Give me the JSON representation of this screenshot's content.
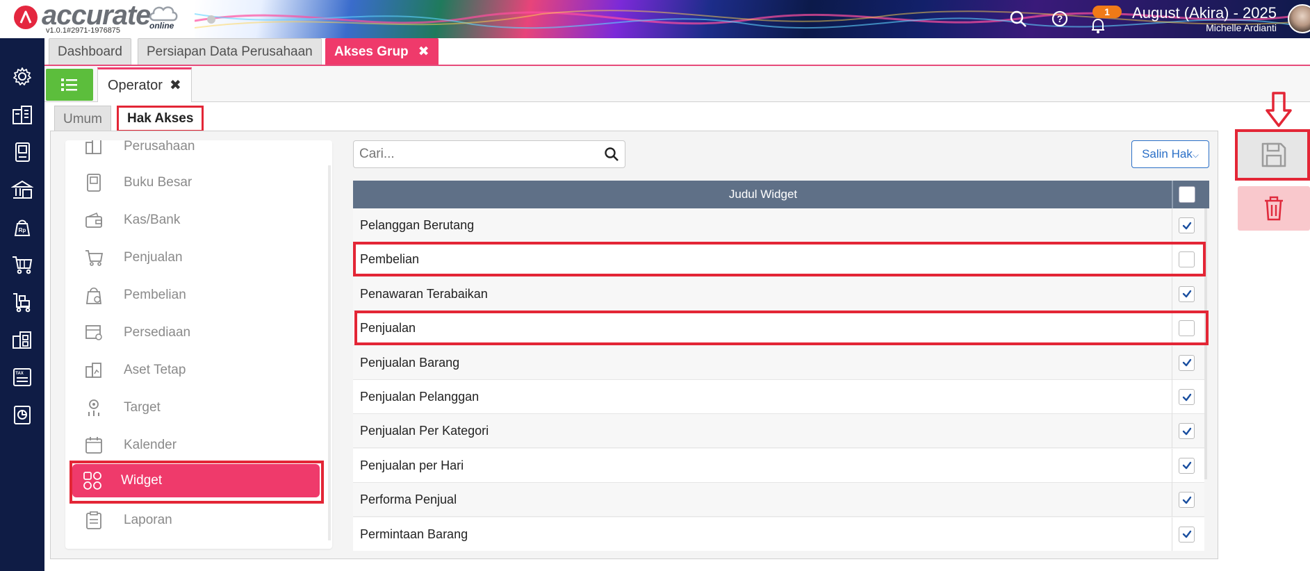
{
  "app": {
    "logo_text": "accurate",
    "logo_subtext": "online",
    "version": "v1.0.1#2971-1976875"
  },
  "header": {
    "notification_count": "1",
    "company": "August (Akira) - 2025",
    "user": "Michelle Ardianti"
  },
  "main_tabs": [
    {
      "label": "Dashboard"
    },
    {
      "label": "Persiapan Data Perusahaan"
    },
    {
      "label": "Akses Grup",
      "close": "✖"
    }
  ],
  "operator_tab": {
    "label": "Operator",
    "close": "✖"
  },
  "inner_tabs": [
    {
      "label": "Umum"
    },
    {
      "label": "Hak Akses"
    }
  ],
  "menu": {
    "items": [
      {
        "label": "Perusahaan",
        "icon": "building-icon"
      },
      {
        "label": "Buku Besar",
        "icon": "ledger-icon"
      },
      {
        "label": "Kas/Bank",
        "icon": "wallet-icon"
      },
      {
        "label": "Penjualan",
        "icon": "cart-icon"
      },
      {
        "label": "Pembelian",
        "icon": "shopping-bag-icon"
      },
      {
        "label": "Persediaan",
        "icon": "inventory-icon"
      },
      {
        "label": "Aset Tetap",
        "icon": "asset-icon"
      },
      {
        "label": "Target",
        "icon": "target-icon"
      },
      {
        "label": "Kalender",
        "icon": "calendar-icon"
      },
      {
        "label": "Widget",
        "icon": "widget-icon",
        "active": true
      },
      {
        "label": "Laporan",
        "icon": "report-icon"
      }
    ]
  },
  "search": {
    "placeholder": "Cari..."
  },
  "copy_button": {
    "label": "Salin Hak"
  },
  "table": {
    "header": "Judul Widget",
    "rows": [
      {
        "label": "Pelanggan Berutang",
        "checked": true
      },
      {
        "label": "Pembelian",
        "checked": false
      },
      {
        "label": "Penawaran Terabaikan",
        "checked": true
      },
      {
        "label": "Penjualan",
        "checked": false
      },
      {
        "label": "Penjualan Barang",
        "checked": true
      },
      {
        "label": "Penjualan Pelanggan",
        "checked": true
      },
      {
        "label": "Penjualan Per Kategori",
        "checked": true
      },
      {
        "label": "Penjualan per Hari",
        "checked": true
      },
      {
        "label": "Performa Penjual",
        "checked": true
      },
      {
        "label": "Permintaan Barang",
        "checked": true
      }
    ]
  },
  "colors": {
    "accent": "#ef3a6b",
    "highlight": "#e32636",
    "sidebar": "#0f1c45",
    "table_header": "#5f7087",
    "check": "#1a4fa0"
  }
}
